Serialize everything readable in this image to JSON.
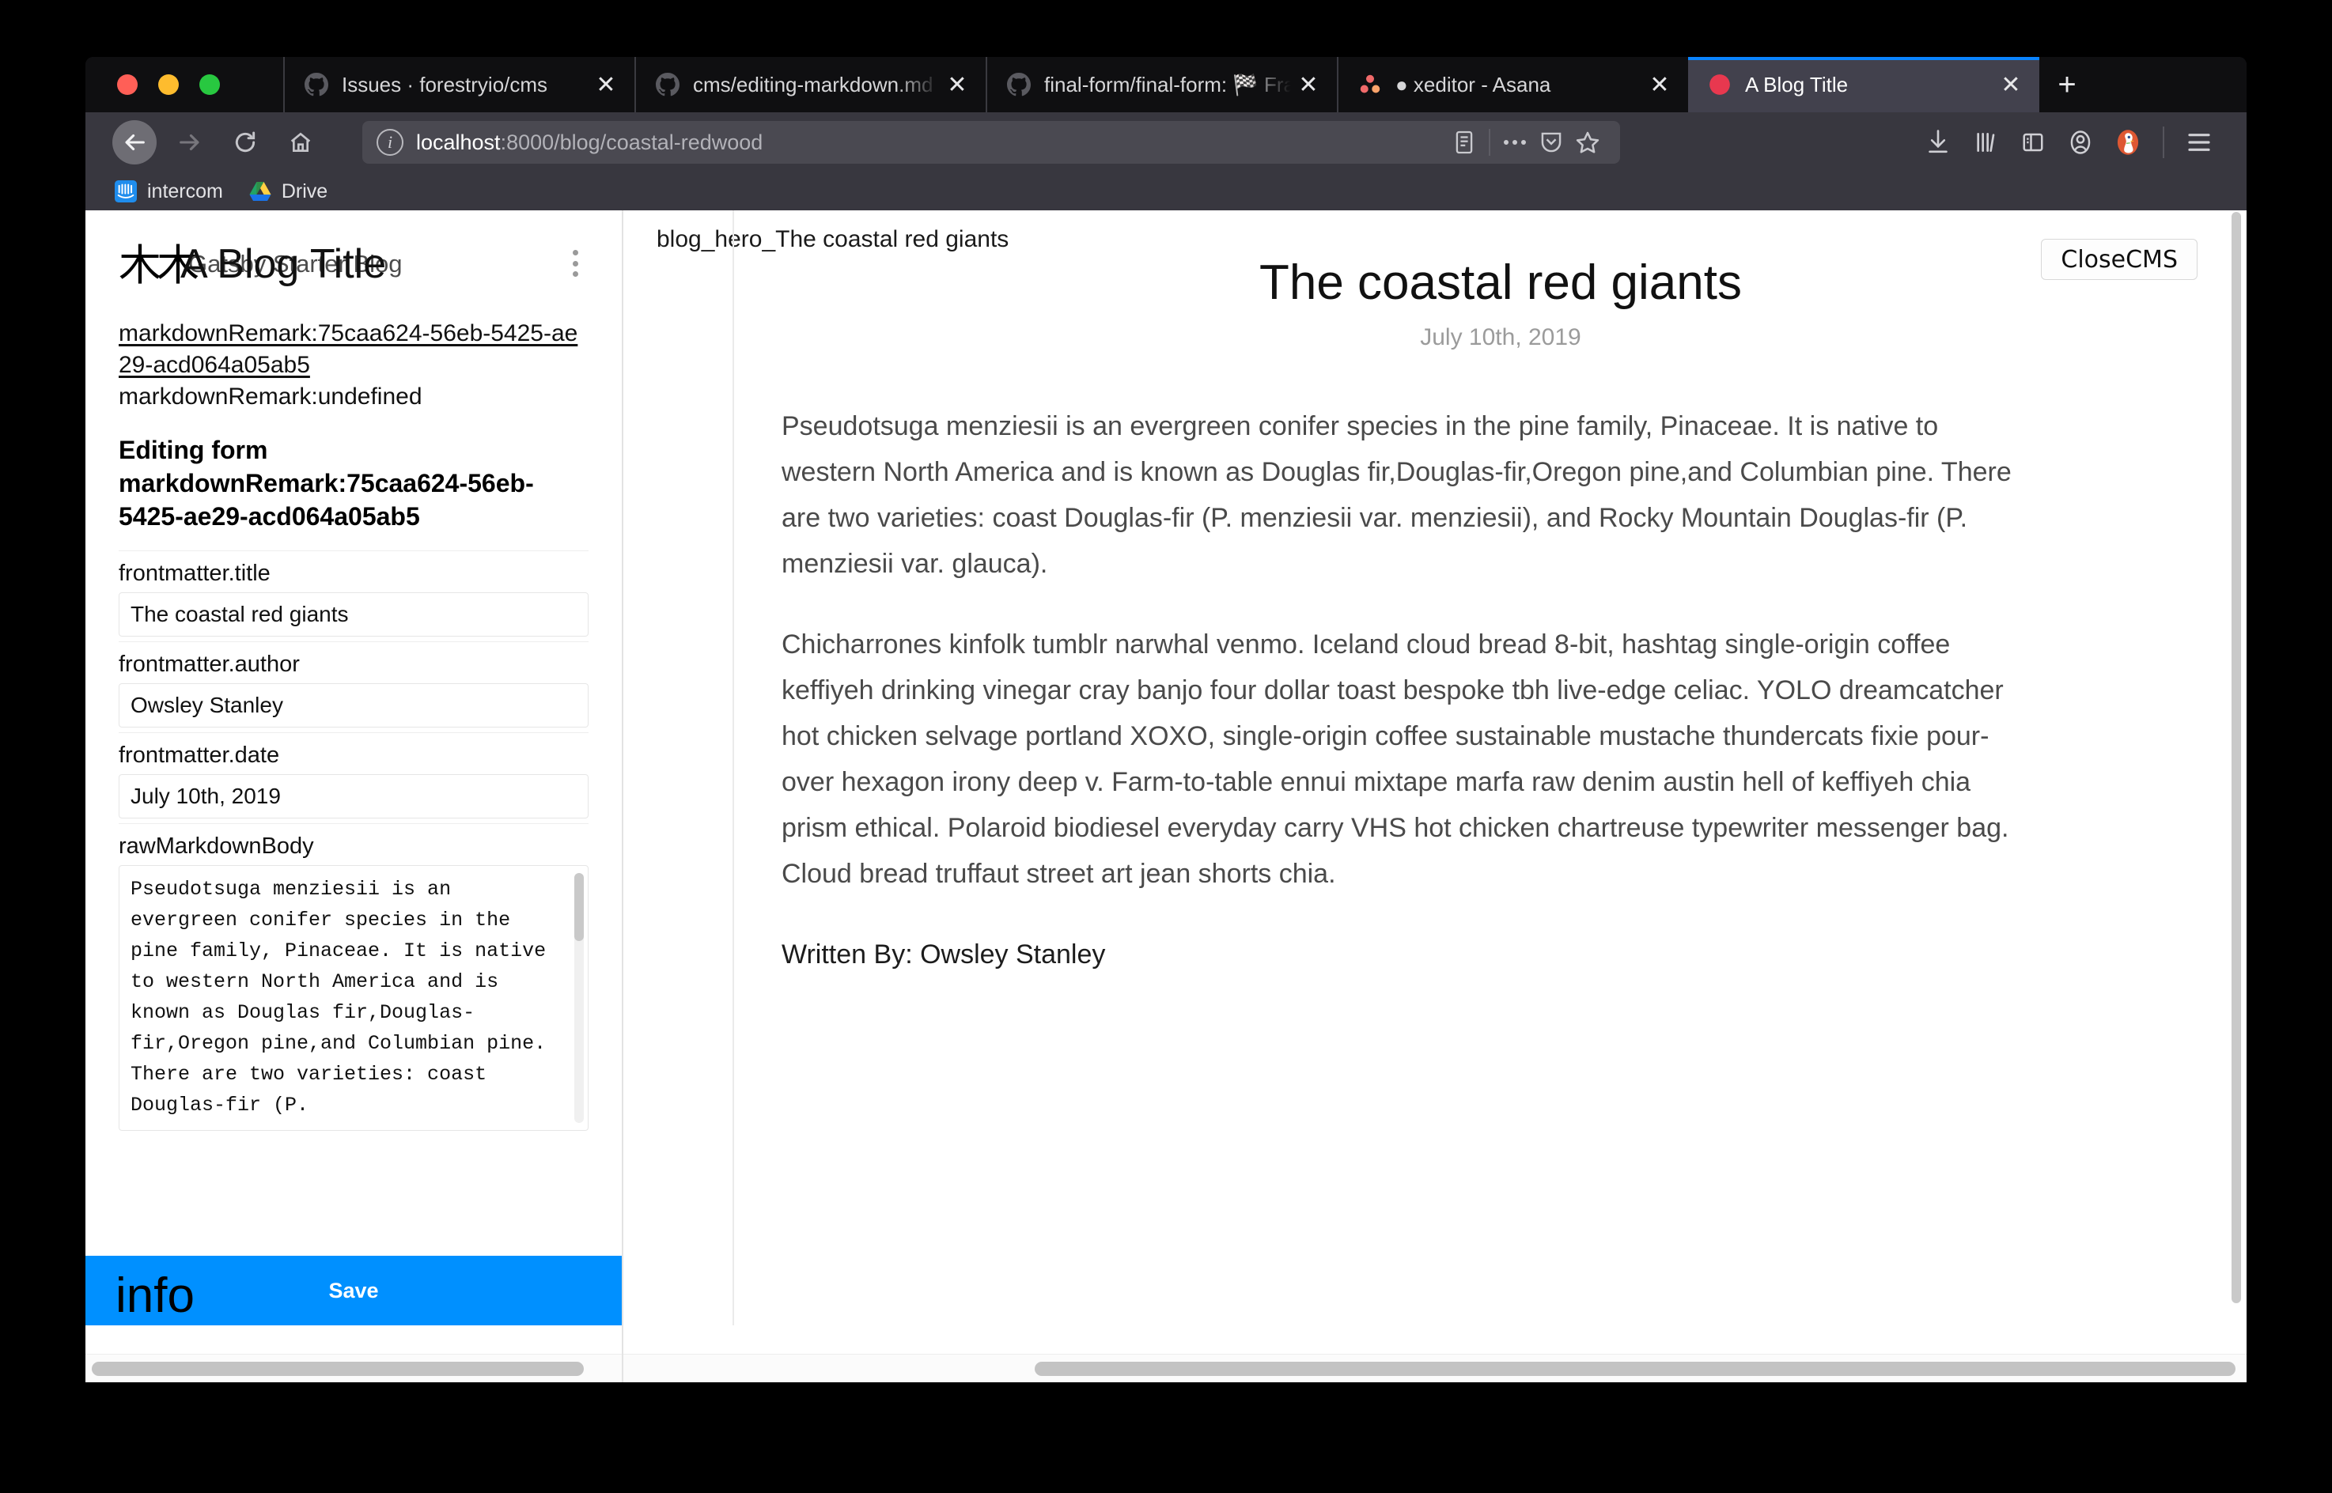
{
  "browser": {
    "tabs": [
      {
        "title": "Issues · forestryio/cms",
        "favicon": "github-icon",
        "active": false
      },
      {
        "title": "cms/editing-markdown.md at m",
        "favicon": "github-icon",
        "active": false
      },
      {
        "title": "final-form/final-form: 🏁 Framew",
        "favicon": "github-icon",
        "active": false
      },
      {
        "title": "● xeditor - Asana",
        "favicon": "asana-icon",
        "active": false
      },
      {
        "title": "A Blog Title",
        "favicon": "red-dot-icon",
        "active": true
      }
    ],
    "new_tab_label": "+",
    "close_label": "✕",
    "url": {
      "host": "localhost",
      "path": ":8000/blog/coastal-redwood"
    },
    "bookmarks": [
      {
        "label": "intercom",
        "icon": "intercom-icon"
      },
      {
        "label": "Drive",
        "icon": "google-drive-icon"
      }
    ],
    "accent_color": "#0a84ff"
  },
  "cms": {
    "brand_logo_glyph": "木木",
    "brand_small_title": "Gatsby Starter Blog",
    "brand_large_title": "A Blog Title",
    "doc_id_link": "markdownRemark:75caa624-56eb-5425-ae29-acd064a05ab5",
    "doc_id_undefined": "markdownRemark:undefined",
    "editing_form_heading_line1": "Editing form",
    "editing_form_heading_line2": "markdownRemark:75caa624-56eb-",
    "editing_form_heading_line3": "5425-ae29-acd064a05ab5",
    "fields": [
      {
        "label": "frontmatter.title",
        "value": "The coastal red giants"
      },
      {
        "label": "frontmatter.author",
        "value": "Owsley Stanley"
      },
      {
        "label": "frontmatter.date",
        "value": "July 10th, 2019"
      }
    ],
    "rawmarkdown_label": "rawMarkdownBody",
    "rawmarkdown_value": "Pseudotsuga menziesii is an evergreen conifer species in the pine family, Pinaceae. It is native to western North America and is known as Douglas fir,Douglas-fir,Oregon pine,and Columbian pine. There are two varieties: coast Douglas-fir (P.",
    "info_text": "info",
    "save_label": "Save",
    "save_color": "#0090ff"
  },
  "preview": {
    "hero_caption": "blog_hero_The coastal red giants",
    "close_cms_label": "CloseCMS",
    "article": {
      "title": "The coastal red giants",
      "date": "July 10th, 2019",
      "paragraphs": [
        "Pseudotsuga menziesii is an evergreen conifer species in the pine family, Pinaceae. It is native to western North America and is known as Douglas fir,Douglas-fir,Oregon pine,and Columbian pine. There are two varieties: coast Douglas-fir (P. menziesii var. menziesii), and Rocky Mountain Douglas-fir (P. menziesii var. glauca).",
        "Chicharrones kinfolk tumblr narwhal venmo. Iceland cloud bread 8-bit, hashtag single-origin coffee keffiyeh drinking vinegar cray banjo four dollar toast bespoke tbh live-edge celiac. YOLO dreamcatcher hot chicken selvage portland XOXO, single-origin coffee sustainable mustache thundercats fixie pour-over hexagon irony deep v. Farm-to-table ennui mixtape marfa raw denim austin hell of keffiyeh chia prism ethical. Polaroid biodiesel everyday carry VHS hot chicken chartreuse typewriter messenger bag. Cloud bread truffaut street art jean shorts chia."
      ],
      "byline": "Written By: Owsley Stanley"
    }
  }
}
